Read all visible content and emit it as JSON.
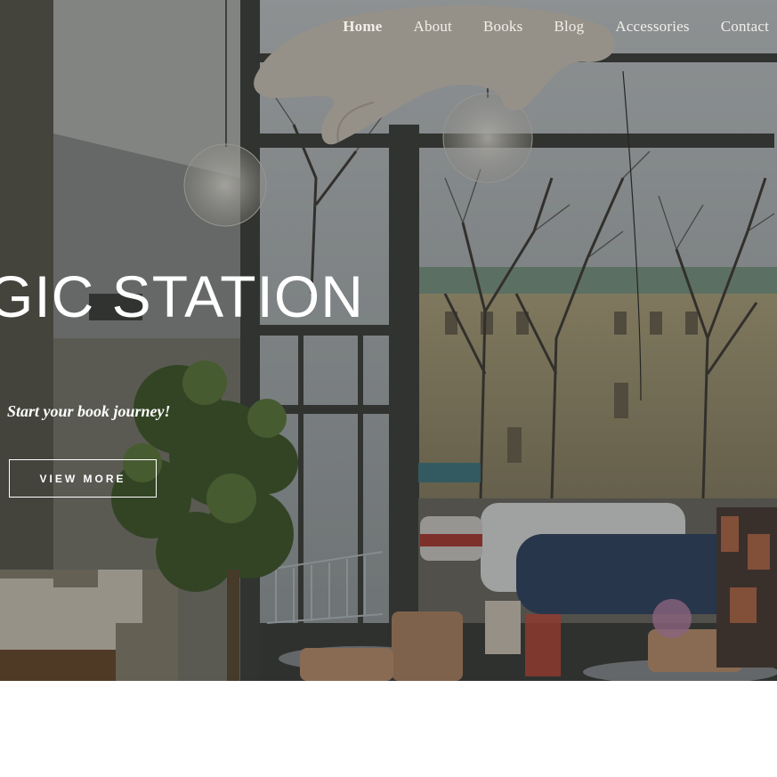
{
  "nav": {
    "items": [
      {
        "label": "Home",
        "active": true
      },
      {
        "label": "About"
      },
      {
        "label": "Books"
      },
      {
        "label": "Blog"
      },
      {
        "label": "Accessories"
      },
      {
        "label": "Contact"
      }
    ]
  },
  "hero": {
    "title": "GIC STATION",
    "tagline": "Start your book journey!",
    "button_label": "VIEW MORE",
    "image_description_icon": "bookstore-photo"
  },
  "colors": {
    "overlay": "#2f302c",
    "text": "#ffffff",
    "nav_text": "#f2efe9"
  }
}
